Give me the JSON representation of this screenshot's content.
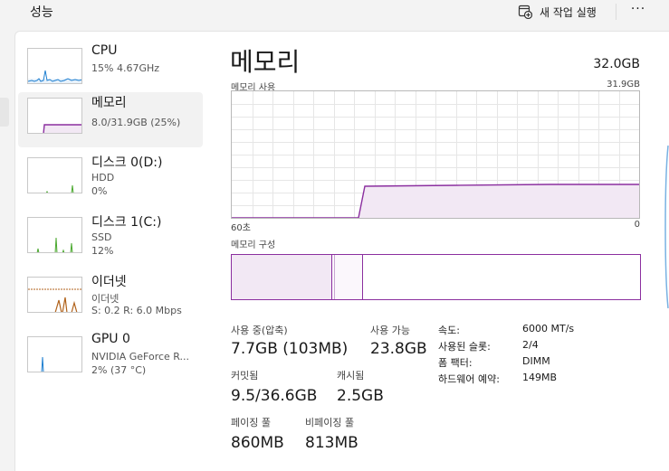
{
  "header": {
    "title": "성능",
    "run_task_label": "새 작업 실행",
    "more_label": "···"
  },
  "sidebar": {
    "items": [
      {
        "name": "CPU",
        "line1": "15%  4.67GHz",
        "line2": ""
      },
      {
        "name": "메모리",
        "line1": "8.0/31.9GB (25%)",
        "line2": ""
      },
      {
        "name": "디스크 0(D:)",
        "line1": "HDD",
        "line2": "0%"
      },
      {
        "name": "디스크 1(C:)",
        "line1": "SSD",
        "line2": "12%"
      },
      {
        "name": "이더넷",
        "line1": "이더넷",
        "line2": "S: 0.2  R: 6.0 Mbps"
      },
      {
        "name": "GPU 0",
        "line1": "NVIDIA GeForce R...",
        "line2": "2%  (37 °C)"
      }
    ]
  },
  "main": {
    "title": "메모리",
    "total": "32.0GB",
    "usage_label": "메모리 사용",
    "usage_max": "31.9GB",
    "time_left": "60초",
    "time_right": "0",
    "usage_fraction": 0.25,
    "composition_label": "메모리 구성",
    "stats": {
      "in_use_label": "사용 중(압축)",
      "in_use_value": "7.7GB (103MB)",
      "available_label": "사용 가능",
      "available_value": "23.8GB",
      "committed_label": "커밋됨",
      "committed_value": "9.5/36.6GB",
      "cached_label": "캐시됨",
      "cached_value": "2.5GB",
      "paged_label": "페이징 풀",
      "paged_value": "860MB",
      "nonpaged_label": "비페이징 풀",
      "nonpaged_value": "813MB"
    },
    "details": [
      {
        "key": "속도:",
        "value": "6000 MT/s"
      },
      {
        "key": "사용된 슬롯:",
        "value": "2/4"
      },
      {
        "key": "폼 팩터:",
        "value": "DIMM"
      },
      {
        "key": "하드웨어 예약:",
        "value": "149MB"
      }
    ]
  },
  "colors": {
    "memory": "#8b2f9f",
    "memory_fill": "#f2e8f4",
    "cpu": "#1f7fd0",
    "disk": "#4aa82e",
    "ethernet": "#b0621b",
    "gpu": "#1f7fd0",
    "grid": "#e6e6e6"
  }
}
